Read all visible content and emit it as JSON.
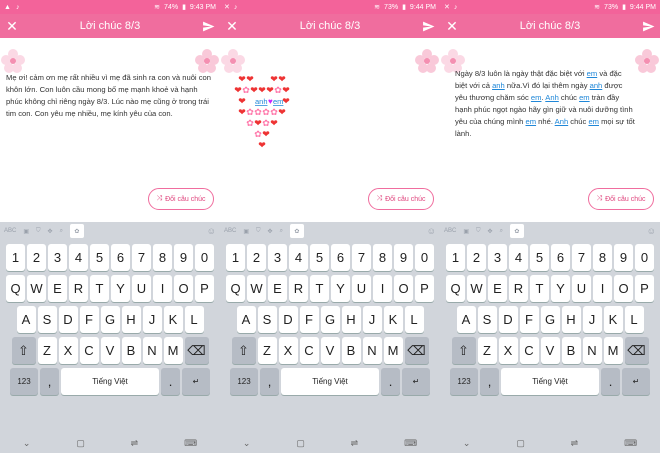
{
  "status": {
    "time_1": "9:43 PM",
    "battery_1": "74%",
    "time_2": "9:44 PM",
    "battery_2": "73%",
    "time_3": "9:44 PM",
    "battery_3": "73%"
  },
  "header": {
    "title": "Lời chúc 8/3"
  },
  "screens": [
    {
      "message": "Mẹ ơi! cảm ơn mẹ rất nhiều vì mẹ đã sinh ra con và nuôi con khôn lớn. Con luôn cầu mong bố mẹ mạnh khoẻ và hạnh phúc không chỉ riêng ngày 8/3. Lúc nào mẹ cũng ở trong trái tim con. Con yêu mẹ nhiều, mẹ kính yêu của con."
    },
    {
      "heart_label_1": "anh",
      "heart_label_2": "em"
    },
    {
      "p1": "Ngày 8/3 luôn là ngày thật đặc biệt với",
      "w_em1": "em",
      "p2": " và đặc biệt với cả ",
      "w_anh1": "anh",
      "p3": " nữa.Vì đó lại thêm ngày ",
      "w_anh2": "anh",
      "p4": " được yêu thương chăm sóc ",
      "w_em2": "em",
      "p5": ". ",
      "w_anh3": "Anh",
      "p6": " chúc ",
      "w_em3": "em",
      "p7": " tràn đầy hạnh phúc ngọt ngào hãy gìn giữ và nuôi dưỡng tình yêu của chúng mình ",
      "w_em4": "em",
      "p8": " nhé. ",
      "w_anh4": "Anh",
      "p9": " chúc ",
      "w_em5": "em",
      "p10": " mọi sự tốt lành."
    }
  ],
  "change_button": {
    "label": "Đổi câu chúc"
  },
  "keyboard": {
    "toolbar_abc": "ABC",
    "numbers": [
      "1",
      "2",
      "3",
      "4",
      "5",
      "6",
      "7",
      "8",
      "9",
      "0"
    ],
    "row1": [
      "Q",
      "W",
      "E",
      "R",
      "T",
      "Y",
      "U",
      "I",
      "O",
      "P"
    ],
    "row2": [
      "A",
      "S",
      "D",
      "F",
      "G",
      "H",
      "J",
      "K",
      "L"
    ],
    "row3": [
      "Z",
      "X",
      "C",
      "V",
      "B",
      "N",
      "M"
    ],
    "mode_label": "123",
    "space_label": "Tiếng Việt"
  },
  "colors": {
    "accent": "#f06d9e",
    "link": "#1f87d8"
  }
}
